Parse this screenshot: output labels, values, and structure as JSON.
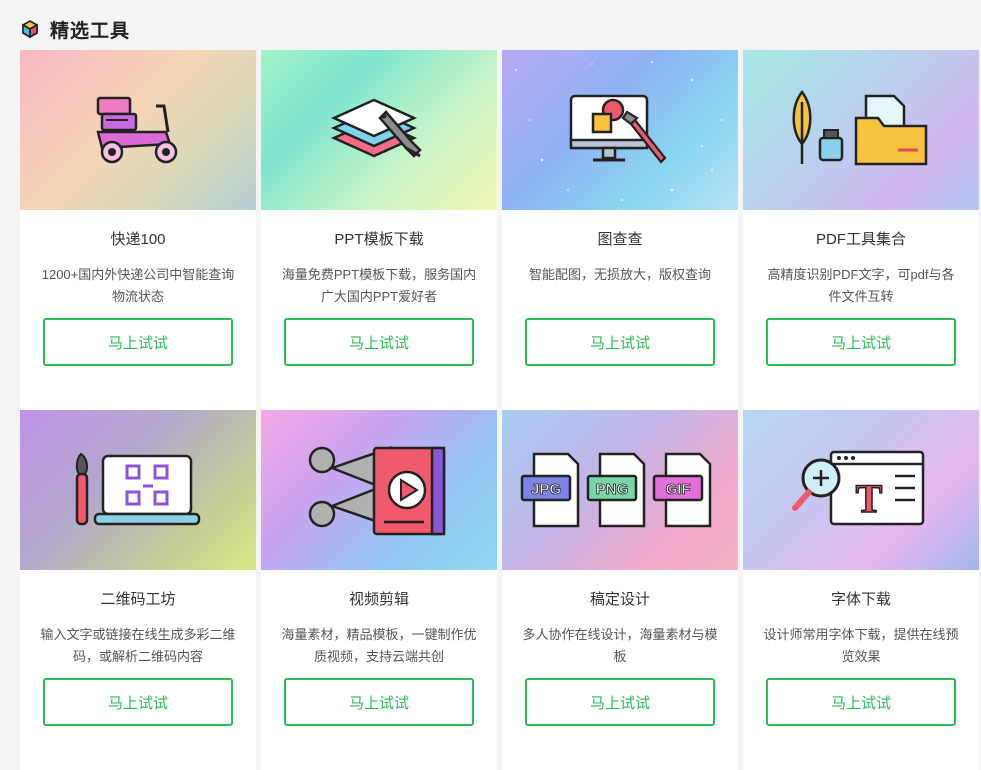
{
  "section": {
    "title": "精选工具",
    "icon": "cube-box-icon"
  },
  "cards": [
    {
      "title": "快递100",
      "desc": "1200+国内外快递公司中智能查询物流状态",
      "button": "马上试试",
      "icon": "delivery-scooter-icon"
    },
    {
      "title": "PPT模板下载",
      "desc": "海量免费PPT模板下载，服务国内广大国内PPT爱好者",
      "button": "马上试试",
      "icon": "layers-pen-icon"
    },
    {
      "title": "图查查",
      "desc": "智能配图，无损放大，版权查询",
      "button": "马上试试",
      "icon": "monitor-paintbrush-icon"
    },
    {
      "title": "PDF工具集合",
      "desc": "高精度识别PDF文字，可pdf与各件文件互转",
      "button": "马上试试",
      "icon": "quill-ink-folder-icon"
    },
    {
      "title": "二维码工坊",
      "desc": "输入文字或链接在线生成多彩二维码，或解析二维码内容",
      "button": "马上试试",
      "icon": "laptop-qrcode-brush-icon"
    },
    {
      "title": "视频剪辑",
      "desc": "海量素材，精品模板，一键制作优质视频，支持云端共创",
      "button": "马上试试",
      "icon": "scissors-film-play-icon"
    },
    {
      "title": "稿定设计",
      "desc": "多人协作在线设计，海量素材与模板",
      "button": "马上试试",
      "icon": "image-file-formats-icon"
    },
    {
      "title": "字体下载",
      "desc": "设计师常用字体下载，提供在线预览效果",
      "button": "马上试试",
      "icon": "magnifier-font-icon"
    }
  ],
  "file_formats": [
    "JPG",
    "PNG",
    "GIF"
  ],
  "font_glyph": "T",
  "colors": {
    "accent": "#2bbd55",
    "background": "#f4f4f5",
    "card": "#ffffff"
  }
}
